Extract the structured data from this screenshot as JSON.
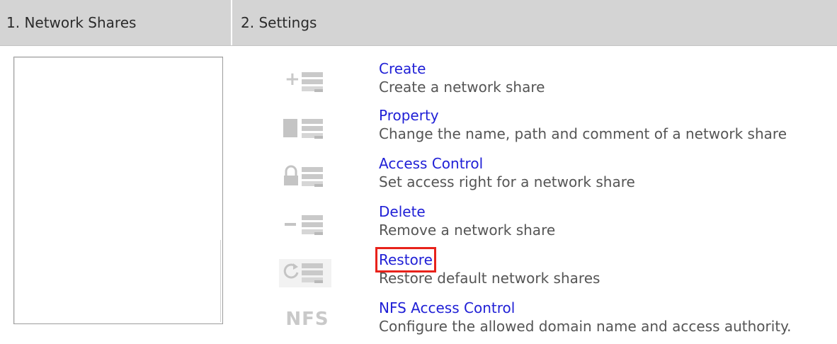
{
  "header": {
    "col1": "1. Network Shares",
    "col2": "2. Settings"
  },
  "actions": [
    {
      "title": "Create",
      "desc": "Create a network share",
      "icon": "create-share-icon"
    },
    {
      "title": "Property",
      "desc": "Change the name, path and comment of a network share",
      "icon": "property-icon"
    },
    {
      "title": "Access Control",
      "desc": "Set access right for a network share",
      "icon": "access-control-lock-icon"
    },
    {
      "title": "Delete",
      "desc": "Remove a network share",
      "icon": "delete-share-icon"
    },
    {
      "title": "Restore",
      "desc": "Restore default network shares",
      "icon": "restore-refresh-icon"
    },
    {
      "title": "NFS Access Control",
      "desc": "Configure the allowed domain name and access authority.",
      "icon": "nfs-icon",
      "icon_text": "NFS"
    }
  ],
  "colors": {
    "link": "#1f1fd6",
    "highlight": "#e8221b",
    "header_bg": "#d4d4d4"
  }
}
